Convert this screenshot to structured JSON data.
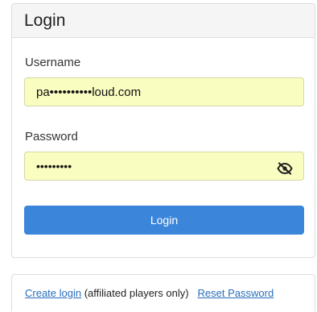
{
  "login_card": {
    "title": "Login",
    "username": {
      "label": "Username",
      "value": "pa••••••••••loud.com"
    },
    "password": {
      "label": "Password",
      "value": "•••••••••",
      "toggle_icon": "eye-slash-icon"
    },
    "submit_label": "Login"
  },
  "footer": {
    "create_login_label": "Create login",
    "affiliated_note": " (affiliated players only)",
    "reset_password_label": "Reset Password"
  },
  "colors": {
    "input_background": "#fafdc0",
    "button_primary": "#3b86db",
    "link": "#2a6ebb"
  }
}
